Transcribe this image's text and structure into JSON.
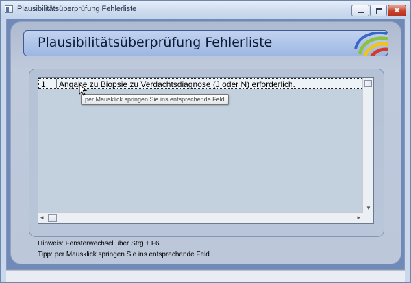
{
  "window": {
    "title": "Plausibilitätsüberprüfung Fehlerliste",
    "controls": {
      "minimize": "minimize",
      "maximize": "maximize",
      "close": "✕"
    }
  },
  "header": {
    "title": "Plausibilitätsüberprüfung Fehlerliste"
  },
  "errors": {
    "rows": [
      {
        "number": "1",
        "text": "Angabe zu Biopsie zu Verdachtsdiagnose  (J oder N) erforderlich."
      }
    ]
  },
  "tooltip": "per Mausklick springen Sie ins entsprechende Feld",
  "hints": {
    "line1": "Hinweis: Fensterwechsel über Strg + F6",
    "line2": "Tipp: per Mausklick springen Sie ins entsprechende Feld"
  },
  "colors": {
    "logo_blue": "#3a66c4",
    "logo_green": "#8cc23f",
    "logo_yellow": "#f2c318",
    "logo_red": "#d83a2a"
  }
}
